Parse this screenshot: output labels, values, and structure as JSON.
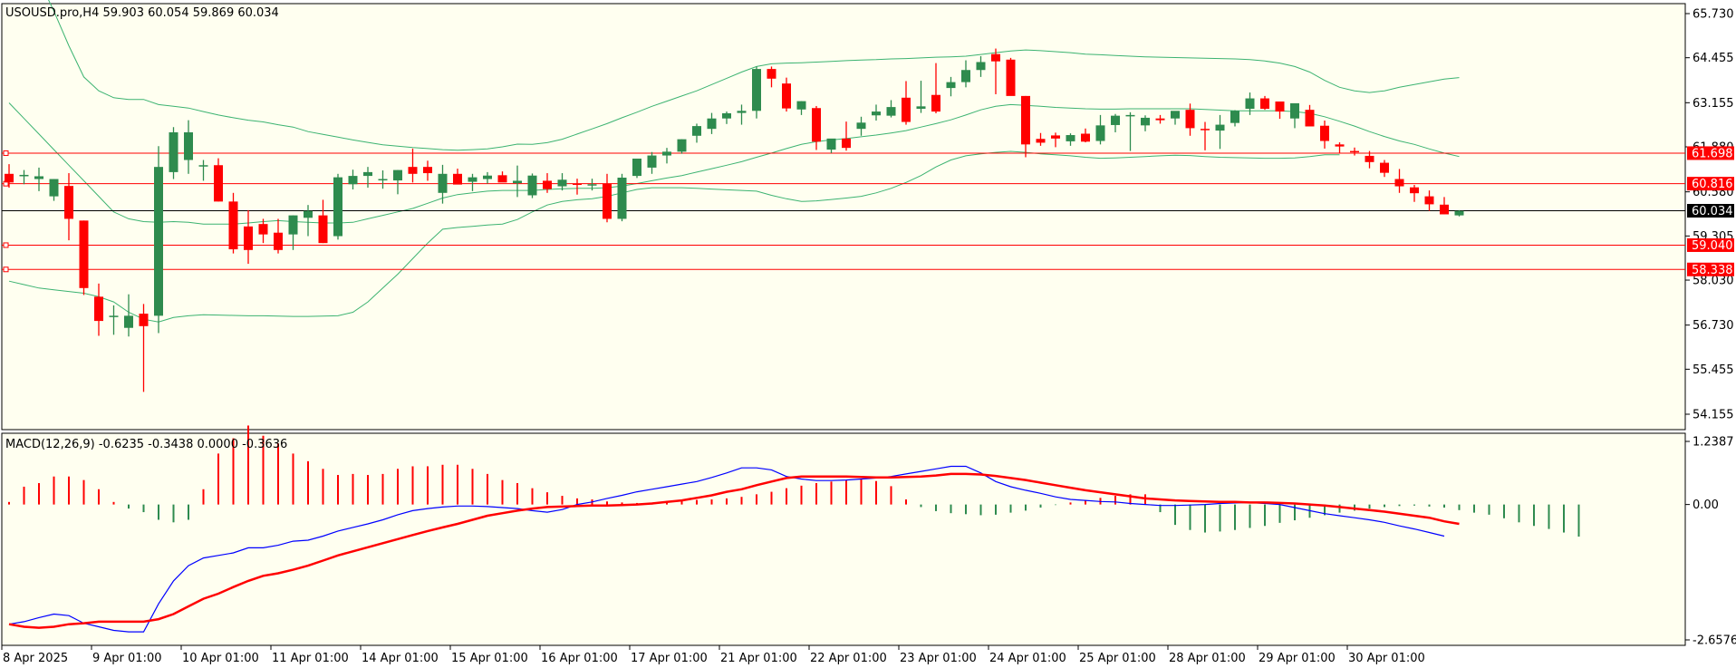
{
  "window": {
    "header": "USOUSD.pro,H4  59.903 60.054 59.869 60.034",
    "macd_header": "MACD(12,26,9) -0.6235 -0.3438 0.0000 -0.3636"
  },
  "colors": {
    "background": "#fffff0",
    "bull": "#2e8b4e",
    "bear": "#ff0000",
    "bands": "#3cb371",
    "hline": "#ff0000",
    "price_line": "#000000",
    "macd_line": "#0000ff",
    "signal_line": "#ff0000"
  },
  "chart_data": [
    {
      "type": "candlestick",
      "symbol": "USOUSD.pro",
      "timeframe": "H4",
      "ylim": [
        54.155,
        65.73
      ],
      "y_ticks": [
        "65.730",
        "64.455",
        "63.155",
        "61.880",
        "60.580",
        "59.305",
        "58.030",
        "56.730",
        "55.455",
        "54.155"
      ],
      "x_ticks": [
        "8 Apr 2025",
        "9 Apr 01:00",
        "10 Apr 01:00",
        "11 Apr 01:00",
        "14 Apr 01:00",
        "15 Apr 01:00",
        "16 Apr 01:00",
        "17 Apr 01:00",
        "21 Apr 01:00",
        "22 Apr 01:00",
        "23 Apr 01:00",
        "24 Apr 01:00",
        "25 Apr 01:00",
        "28 Apr 01:00",
        "29 Apr 01:00",
        "30 Apr 01:00"
      ],
      "candles": [
        [
          61.1,
          61.38,
          60.7,
          60.85
        ],
        [
          61.03,
          61.21,
          60.8,
          61.07
        ],
        [
          60.95,
          61.28,
          60.6,
          61.03
        ],
        [
          60.45,
          60.95,
          60.32,
          60.95
        ],
        [
          60.75,
          61.12,
          59.18,
          59.8
        ],
        [
          59.75,
          59.75,
          57.6,
          57.8
        ],
        [
          57.55,
          57.93,
          56.42,
          56.85
        ],
        [
          57.0,
          57.3,
          56.45,
          57.0
        ],
        [
          56.65,
          57.62,
          56.4,
          57.0
        ],
        [
          57.06,
          57.34,
          54.8,
          56.7
        ],
        [
          57.0,
          61.9,
          56.5,
          61.3
        ],
        [
          61.15,
          62.45,
          60.95,
          62.3
        ],
        [
          61.5,
          62.65,
          61.1,
          62.3
        ],
        [
          61.35,
          61.5,
          60.9,
          61.35
        ],
        [
          61.35,
          61.55,
          60.3,
          60.3
        ],
        [
          60.3,
          60.55,
          58.8,
          58.92
        ],
        [
          59.58,
          60.05,
          58.5,
          58.9
        ],
        [
          59.65,
          59.8,
          59.1,
          59.35
        ],
        [
          59.4,
          59.8,
          58.8,
          58.9
        ],
        [
          59.35,
          59.9,
          58.9,
          59.9
        ],
        [
          59.83,
          60.2,
          59.3,
          60.03
        ],
        [
          59.9,
          60.35,
          59.1,
          59.1
        ],
        [
          59.3,
          61.1,
          59.2,
          61.0
        ],
        [
          60.8,
          61.22,
          60.65,
          61.04
        ],
        [
          61.04,
          61.3,
          60.7,
          61.15
        ],
        [
          60.92,
          61.2,
          60.67,
          60.95
        ],
        [
          60.91,
          61.21,
          60.51,
          61.21
        ],
        [
          61.3,
          61.83,
          60.85,
          61.1
        ],
        [
          61.3,
          61.48,
          60.9,
          61.12
        ],
        [
          60.55,
          61.36,
          60.24,
          61.1
        ],
        [
          61.1,
          61.25,
          60.85,
          60.79
        ],
        [
          60.87,
          61.1,
          60.6,
          61.0
        ],
        [
          60.95,
          61.15,
          60.82,
          61.05
        ],
        [
          61.06,
          61.17,
          60.9,
          60.85
        ],
        [
          60.83,
          61.34,
          60.43,
          60.9
        ],
        [
          60.48,
          61.11,
          60.4,
          61.05
        ],
        [
          60.9,
          61.12,
          60.55,
          60.66
        ],
        [
          60.74,
          61.12,
          60.62,
          60.93
        ],
        [
          60.82,
          60.96,
          60.5,
          60.8
        ],
        [
          60.8,
          60.96,
          60.62,
          60.8
        ],
        [
          60.82,
          61.1,
          59.7,
          59.8
        ],
        [
          59.8,
          61.1,
          59.73,
          60.99
        ],
        [
          61.04,
          61.54,
          60.98,
          61.54
        ],
        [
          61.28,
          61.73,
          61.1,
          61.63
        ],
        [
          61.63,
          61.85,
          61.4,
          61.74
        ],
        [
          61.74,
          62.1,
          61.68,
          62.1
        ],
        [
          62.2,
          62.55,
          62.0,
          62.48
        ],
        [
          62.4,
          62.86,
          62.25,
          62.7
        ],
        [
          62.7,
          62.9,
          62.54,
          62.85
        ],
        [
          62.86,
          63.1,
          62.52,
          62.92
        ],
        [
          62.92,
          64.2,
          62.7,
          64.13
        ],
        [
          64.13,
          64.2,
          63.6,
          63.85
        ],
        [
          63.71,
          63.88,
          62.9,
          62.99
        ],
        [
          62.96,
          63.2,
          62.8,
          63.2
        ],
        [
          63.0,
          63.06,
          61.79,
          62.03
        ],
        [
          61.8,
          62.1,
          61.7,
          62.12
        ],
        [
          62.12,
          62.61,
          61.77,
          61.85
        ],
        [
          62.4,
          62.75,
          62.2,
          62.58
        ],
        [
          62.79,
          63.1,
          62.64,
          62.9
        ],
        [
          62.78,
          63.23,
          62.73,
          63.03
        ],
        [
          63.3,
          63.78,
          62.52,
          62.6
        ],
        [
          62.98,
          63.79,
          62.86,
          63.05
        ],
        [
          63.38,
          64.3,
          62.85,
          62.9
        ],
        [
          63.58,
          63.9,
          63.34,
          63.75
        ],
        [
          63.75,
          64.38,
          63.6,
          64.1
        ],
        [
          64.1,
          64.5,
          63.9,
          64.33
        ],
        [
          64.56,
          64.72,
          63.4,
          64.35
        ],
        [
          64.4,
          64.45,
          63.4,
          63.35
        ],
        [
          63.35,
          63.35,
          61.58,
          61.95
        ],
        [
          62.11,
          62.28,
          61.91,
          62.0
        ],
        [
          62.21,
          62.29,
          61.87,
          62.12
        ],
        [
          62.04,
          62.27,
          61.91,
          62.22
        ],
        [
          62.26,
          62.41,
          62.01,
          62.03
        ],
        [
          62.05,
          62.8,
          61.95,
          62.5
        ],
        [
          62.51,
          62.83,
          62.3,
          62.78
        ],
        [
          62.78,
          62.88,
          61.76,
          62.8
        ],
        [
          62.5,
          62.79,
          62.33,
          62.72
        ],
        [
          62.7,
          62.8,
          62.55,
          62.65
        ],
        [
          62.7,
          62.9,
          62.52,
          62.92
        ],
        [
          62.95,
          63.13,
          62.2,
          62.42
        ],
        [
          62.4,
          62.6,
          61.78,
          62.38
        ],
        [
          62.35,
          62.8,
          61.82,
          62.52
        ],
        [
          62.57,
          62.94,
          62.47,
          62.92
        ],
        [
          62.98,
          63.45,
          62.8,
          63.28
        ],
        [
          63.28,
          63.35,
          62.95,
          62.98
        ],
        [
          63.19,
          63.19,
          62.69,
          62.9
        ],
        [
          62.7,
          63.1,
          62.42,
          63.14
        ],
        [
          62.95,
          63.09,
          62.5,
          62.47
        ],
        [
          62.49,
          62.64,
          61.83,
          62.05
        ],
        [
          61.95,
          62.01,
          61.71,
          61.89
        ],
        [
          61.76,
          61.86,
          61.63,
          61.75
        ],
        [
          61.62,
          61.76,
          61.26,
          61.44
        ],
        [
          61.42,
          61.5,
          61.01,
          61.13
        ],
        [
          60.95,
          61.24,
          60.55,
          60.74
        ],
        [
          60.71,
          60.78,
          60.29,
          60.54
        ],
        [
          60.45,
          60.62,
          60.03,
          60.22
        ],
        [
          60.21,
          60.43,
          59.93,
          59.93
        ],
        [
          59.9,
          60.05,
          59.87,
          60.03
        ]
      ],
      "bollinger": {
        "upper": [
          68.3,
          67.5,
          66.7,
          65.8,
          64.8,
          63.9,
          63.5,
          63.3,
          63.25,
          63.25,
          63.1,
          63.05,
          63.0,
          62.9,
          62.8,
          62.72,
          62.65,
          62.6,
          62.52,
          62.45,
          62.32,
          62.24,
          62.16,
          62.08,
          62.01,
          61.94,
          61.9,
          61.86,
          61.83,
          61.8,
          61.78,
          61.8,
          61.82,
          61.88,
          61.96,
          61.95,
          62.0,
          62.1,
          62.25,
          62.4,
          62.55,
          62.72,
          62.88,
          63.05,
          63.2,
          63.35,
          63.5,
          63.68,
          63.86,
          64.04,
          64.2,
          64.28,
          64.3,
          64.31,
          64.33,
          64.35,
          64.37,
          64.39,
          64.4,
          64.42,
          64.43,
          64.45,
          64.47,
          64.48,
          64.5,
          64.55,
          64.6,
          64.65,
          64.68,
          64.66,
          64.63,
          64.6,
          64.56,
          64.54,
          64.52,
          64.5,
          64.48,
          64.47,
          64.46,
          64.45,
          64.44,
          64.43,
          64.42,
          64.4,
          64.36,
          64.3,
          64.2,
          64.04,
          63.8,
          63.6,
          63.5,
          63.45,
          63.5,
          63.6,
          63.68,
          63.76,
          63.84,
          63.88
        ],
        "middle": [
          63.15,
          62.7,
          62.25,
          61.8,
          61.35,
          60.9,
          60.45,
          60.0,
          59.8,
          59.72,
          59.7,
          59.72,
          59.7,
          59.65,
          59.65,
          59.65,
          59.68,
          59.72,
          59.75,
          59.72,
          59.7,
          59.68,
          59.68,
          59.7,
          59.8,
          59.9,
          60.0,
          60.1,
          60.25,
          60.4,
          60.5,
          60.55,
          60.6,
          60.62,
          60.62,
          60.62,
          60.65,
          60.67,
          60.68,
          60.68,
          60.7,
          60.75,
          60.82,
          60.9,
          60.98,
          61.05,
          61.15,
          61.25,
          61.35,
          61.45,
          61.58,
          61.7,
          61.83,
          61.95,
          62.03,
          62.08,
          62.12,
          62.17,
          62.22,
          62.28,
          62.35,
          62.45,
          62.55,
          62.66,
          62.8,
          62.95,
          63.05,
          63.1,
          63.08,
          63.05,
          63.02,
          63.0,
          62.98,
          62.97,
          62.97,
          62.98,
          62.98,
          62.98,
          62.98,
          62.98,
          62.96,
          62.94,
          62.92,
          62.92,
          62.92,
          62.92,
          62.9,
          62.85,
          62.75,
          62.62,
          62.48,
          62.32,
          62.18,
          62.05,
          61.95,
          61.82,
          61.7,
          61.6
        ],
        "lower": [
          58.0,
          57.9,
          57.8,
          57.75,
          57.7,
          57.65,
          57.55,
          57.4,
          57.1,
          56.9,
          56.82,
          56.95,
          57.0,
          57.03,
          57.02,
          57.01,
          57.0,
          57.0,
          56.99,
          56.98,
          56.98,
          56.99,
          57.0,
          57.1,
          57.4,
          57.8,
          58.2,
          58.65,
          59.1,
          59.5,
          59.55,
          59.58,
          59.62,
          59.65,
          59.78,
          60.0,
          60.2,
          60.3,
          60.35,
          60.38,
          60.45,
          60.55,
          60.65,
          60.7,
          60.7,
          60.7,
          60.68,
          60.66,
          60.64,
          60.62,
          60.6,
          60.48,
          60.38,
          60.3,
          60.32,
          60.36,
          60.4,
          60.45,
          60.55,
          60.68,
          60.85,
          61.05,
          61.3,
          61.5,
          61.62,
          61.68,
          61.72,
          61.75,
          61.72,
          61.68,
          61.65,
          61.62,
          61.58,
          61.55,
          61.56,
          61.58,
          61.6,
          61.62,
          61.64,
          61.63,
          61.6,
          61.58,
          61.57,
          61.56,
          61.55,
          61.55,
          61.56,
          61.6,
          61.65,
          61.65
        ]
      },
      "hlines": [
        {
          "price": 61.698,
          "label": "61.698"
        },
        {
          "price": 60.816,
          "label": "60.816"
        },
        {
          "price": 59.04,
          "label": "59.040"
        },
        {
          "price": 58.338,
          "label": "58.338"
        }
      ],
      "current_price": {
        "price": 60.034,
        "label": "60.034"
      }
    },
    {
      "type": "macd",
      "params": "MACD(12,26,9)",
      "ylim": [
        -2.6576,
        1.2387
      ],
      "y_ticks": [
        "1.2387",
        "0.00",
        "-2.6576"
      ],
      "histogram": [
        0.05,
        0.35,
        0.42,
        0.55,
        0.55,
        0.48,
        0.3,
        0.05,
        -0.08,
        -0.15,
        -0.3,
        -0.35,
        -0.3,
        0.3,
        1.0,
        1.3,
        1.55,
        1.35,
        1.2,
        1.0,
        0.85,
        0.7,
        0.58,
        0.6,
        0.58,
        0.6,
        0.7,
        0.75,
        0.75,
        0.78,
        0.78,
        0.7,
        0.6,
        0.48,
        0.42,
        0.32,
        0.24,
        0.17,
        0.12,
        0.1,
        0.06,
        0.04,
        0.03,
        0.02,
        0.07,
        0.08,
        0.09,
        0.1,
        0.12,
        0.15,
        0.2,
        0.25,
        0.32,
        0.37,
        0.42,
        0.45,
        0.47,
        0.5,
        0.46,
        0.36,
        0.1,
        -0.05,
        -0.13,
        -0.17,
        -0.19,
        -0.21,
        -0.2,
        -0.16,
        -0.12,
        -0.06,
        -0.01,
        0.04,
        0.08,
        0.13,
        0.17,
        0.2,
        0.2,
        -0.15,
        -0.4,
        -0.5,
        -0.55,
        -0.53,
        -0.5,
        -0.46,
        -0.42,
        -0.36,
        -0.31,
        -0.26,
        -0.21,
        -0.16,
        -0.12,
        -0.08,
        -0.05,
        -0.03,
        -0.02,
        -0.04,
        -0.06,
        -0.11,
        -0.16,
        -0.2,
        -0.27,
        -0.35,
        -0.42,
        -0.48,
        -0.55,
        -0.63
      ],
      "macd": [
        -2.35,
        -2.3,
        -2.22,
        -2.15,
        -2.18,
        -2.33,
        -2.4,
        -2.47,
        -2.5,
        -2.5,
        -1.95,
        -1.5,
        -1.2,
        -1.05,
        -1.0,
        -0.95,
        -0.85,
        -0.85,
        -0.8,
        -0.72,
        -0.7,
        -0.62,
        -0.52,
        -0.45,
        -0.38,
        -0.3,
        -0.2,
        -0.12,
        -0.08,
        -0.05,
        -0.03,
        -0.03,
        -0.04,
        -0.06,
        -0.08,
        -0.12,
        -0.15,
        -0.1,
        0.0,
        0.05,
        0.12,
        0.18,
        0.25,
        0.3,
        0.35,
        0.4,
        0.45,
        0.53,
        0.62,
        0.72,
        0.72,
        0.68,
        0.55,
        0.5,
        0.47,
        0.47,
        0.48,
        0.5,
        0.52,
        0.55,
        0.6,
        0.65,
        0.7,
        0.75,
        0.75,
        0.62,
        0.45,
        0.35,
        0.28,
        0.22,
        0.15,
        0.1,
        0.08,
        0.06,
        0.05,
        0.02,
        0.0,
        -0.02,
        -0.02,
        -0.01,
        0.0,
        0.02,
        0.03,
        0.04,
        0.02,
        0.0,
        -0.06,
        -0.12,
        -0.18,
        -0.22,
        -0.26,
        -0.3,
        -0.35,
        -0.42,
        -0.48,
        -0.55,
        -0.62
      ],
      "signal": [
        -2.35,
        -2.4,
        -2.42,
        -2.4,
        -2.35,
        -2.33,
        -2.3,
        -2.3,
        -2.3,
        -2.3,
        -2.25,
        -2.15,
        -2.0,
        -1.85,
        -1.75,
        -1.62,
        -1.5,
        -1.4,
        -1.35,
        -1.28,
        -1.2,
        -1.1,
        -1.0,
        -0.92,
        -0.84,
        -0.76,
        -0.68,
        -0.6,
        -0.52,
        -0.45,
        -0.38,
        -0.3,
        -0.22,
        -0.17,
        -0.12,
        -0.08,
        -0.05,
        -0.04,
        -0.03,
        -0.02,
        -0.02,
        -0.01,
        0.0,
        0.02,
        0.05,
        0.08,
        0.13,
        0.18,
        0.25,
        0.3,
        0.38,
        0.45,
        0.52,
        0.55,
        0.55,
        0.55,
        0.55,
        0.54,
        0.53,
        0.53,
        0.54,
        0.55,
        0.57,
        0.6,
        0.6,
        0.59,
        0.56,
        0.52,
        0.48,
        0.43,
        0.38,
        0.33,
        0.28,
        0.24,
        0.2,
        0.16,
        0.12,
        0.1,
        0.08,
        0.07,
        0.06,
        0.05,
        0.05,
        0.04,
        0.04,
        0.03,
        0.02,
        0.0,
        -0.02,
        -0.05,
        -0.08,
        -0.11,
        -0.14,
        -0.18,
        -0.22,
        -0.26,
        -0.33,
        -0.38
      ]
    }
  ]
}
